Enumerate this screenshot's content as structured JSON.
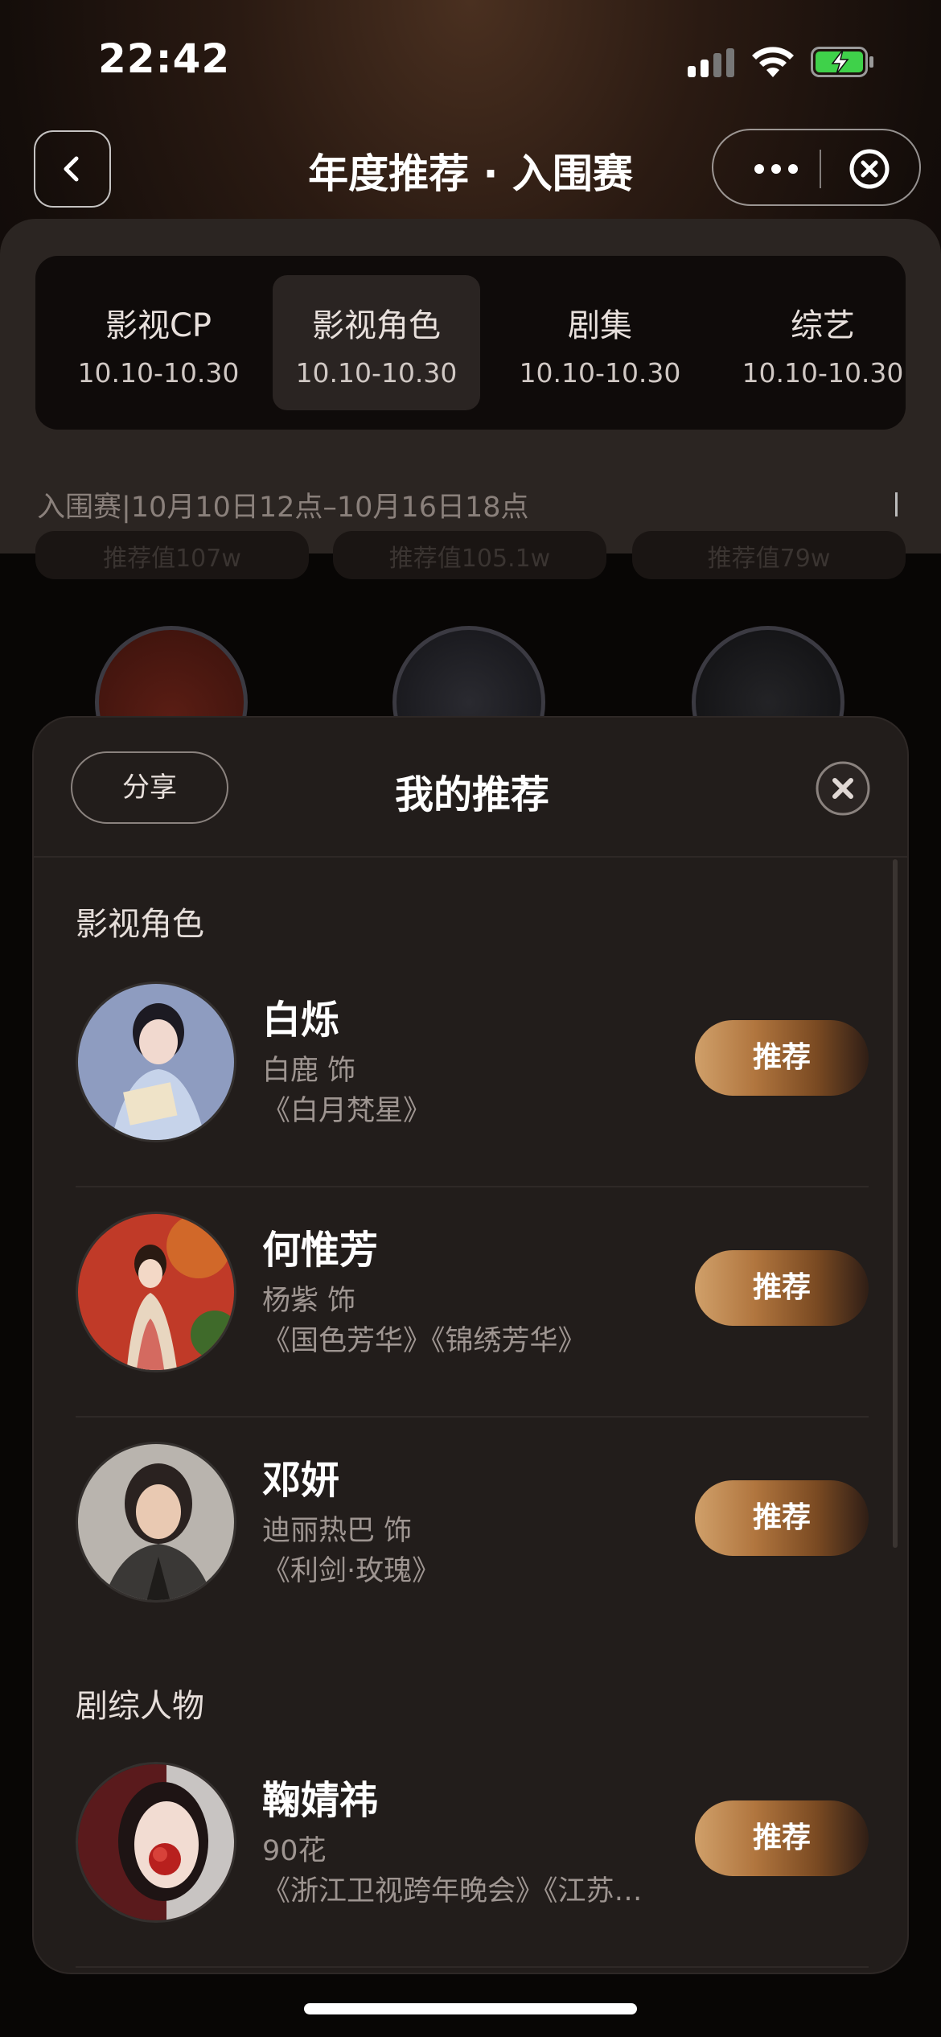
{
  "status_bar": {
    "time": "22:42"
  },
  "nav": {
    "title": "年度推荐 · 入围赛"
  },
  "tabs": [
    {
      "label": "影视CP",
      "date": "10.10-10.30",
      "active": false
    },
    {
      "label": "影视角色",
      "date": "10.10-10.30",
      "active": true
    },
    {
      "label": "剧集",
      "date": "10.10-10.30",
      "active": false
    },
    {
      "label": "综艺",
      "date": "10.10-10.30",
      "active": false
    }
  ],
  "race_info": "入围赛|10月10日12点–10月16日18点",
  "background_cards": [
    "推荐值107w",
    "推荐值105.1w",
    "推荐值79w"
  ],
  "sheet": {
    "share_label": "分享",
    "title": "我的推荐",
    "sections": [
      {
        "title": "影视角色",
        "items": [
          {
            "name": "白烁",
            "actor": "白鹿 饰",
            "works": "《白月梵星》",
            "button": "推荐"
          },
          {
            "name": "何惟芳",
            "actor": "杨紫 饰",
            "works": "《国色芳华》《锦绣芳华》",
            "button": "推荐"
          },
          {
            "name": "邓妍",
            "actor": "迪丽热巴 饰",
            "works": "《利剑·玫瑰》",
            "button": "推荐"
          }
        ]
      },
      {
        "title": "剧综人物",
        "items": [
          {
            "name": "鞠婧祎",
            "actor": "90花",
            "works": "《浙江卫视跨年晚会》《江苏卫视跨年晚会》",
            "button": "推荐"
          }
        ]
      }
    ]
  },
  "colors": {
    "accent_gold": "#c08a50",
    "sheet_bg": "#221d1b",
    "panel_bg": "#2b2522"
  }
}
